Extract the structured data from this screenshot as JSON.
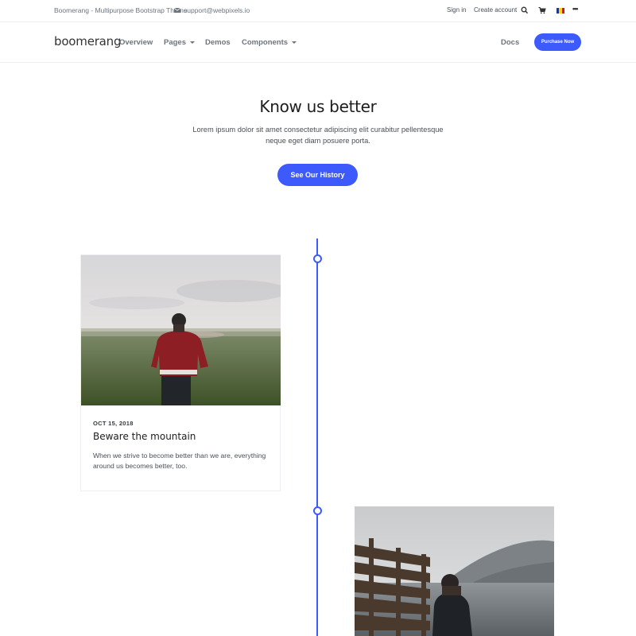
{
  "topbar": {
    "site_title": "Boomerang - Multipurpose Bootstrap Theme",
    "email": "support@webpixels.io",
    "sign_in": "Sign in",
    "create_account": "Create account",
    "icons": [
      "mail-icon",
      "search-icon",
      "cart-icon",
      "flag-icon",
      "more-icon"
    ],
    "more": "•••"
  },
  "navbar": {
    "logo": "boomerang",
    "items": [
      {
        "label": "Overview"
      },
      {
        "label": "Pages",
        "dropdown": true
      },
      {
        "label": "Demos"
      },
      {
        "label": "Components",
        "dropdown": true
      }
    ],
    "docs": "Docs",
    "purchase": "Purchase Now"
  },
  "hero": {
    "title": "Know us better",
    "text": "Lorem ipsum dolor sit amet consectetur adipiscing elit curabitur pellentesque neque eget diam posuere porta.",
    "button": "See Our History"
  },
  "timeline": {
    "entries": [
      {
        "date": "OCT 15, 2018",
        "title": "Beware the mountain",
        "text": "When we strive to become better than we are, everything around us becomes better, too."
      }
    ]
  },
  "colors": {
    "accent": "#3d5afe",
    "text_muted": "#6c757d",
    "heading": "#1d1d1f"
  }
}
